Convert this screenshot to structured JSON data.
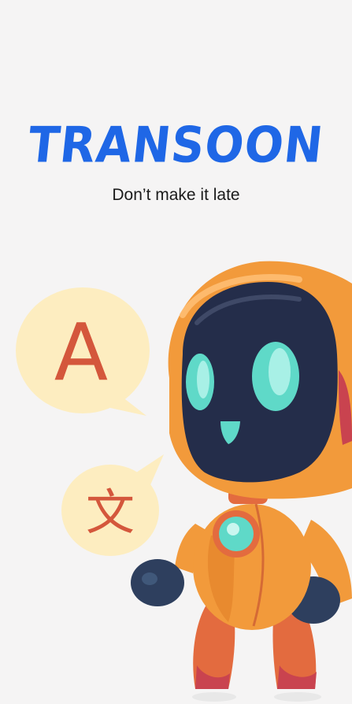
{
  "app": {
    "logo_text": "TRANSOON",
    "tagline": "Don’t make it late"
  },
  "illustration": {
    "bubble_letter_latin": "A",
    "bubble_letter_cjk": "文",
    "colors": {
      "brand_blue": "#1f67e6",
      "bubble_fill": "#fdedc0",
      "glyph_red": "#d4573c",
      "robot_orange": "#f29a3b",
      "visor_navy": "#242d4a",
      "eye_teal": "#5fd9c8"
    }
  }
}
